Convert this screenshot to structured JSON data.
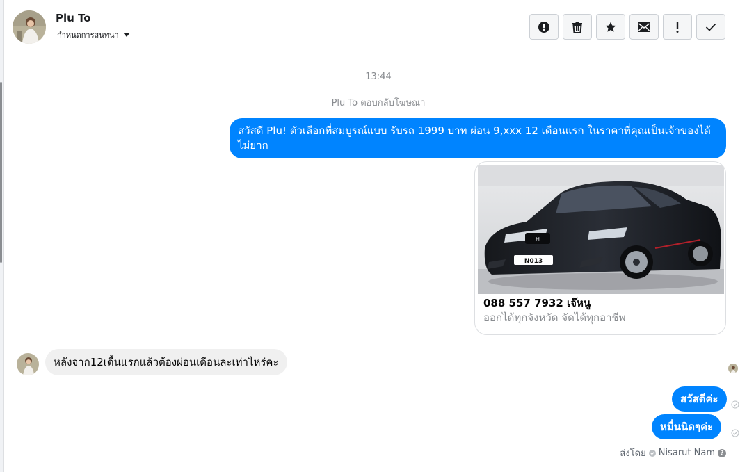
{
  "header": {
    "contact_name": "Plu To",
    "assign_label": "กำหนดการสนทนา",
    "tools": [
      {
        "icon": "spam-alert-icon",
        "label": "spam"
      },
      {
        "icon": "trash-icon",
        "label": "delete"
      },
      {
        "icon": "star-icon",
        "label": "star"
      },
      {
        "icon": "envelope-icon",
        "label": "mark-unread"
      },
      {
        "icon": "exclamation-icon",
        "label": "follow-up"
      },
      {
        "icon": "checkmark-icon",
        "label": "mark-done"
      }
    ]
  },
  "thread": {
    "timestamp": "13:44",
    "ad_reply_note": "Plu To ตอบกลับโฆษณา",
    "outgoing_main": "สวัสดี Plu! ตัวเลือกที่สมบูรณ์แบบ รับรถ 1999 บาท ผ่อน 9,xxx 12 เดือนแรก ในราคาที่คุณเป็นเจ้าของได้ไม่ยาก",
    "card": {
      "title": "088 557 7932 เจ๊หนู",
      "subtitle": "ออกได้ทุกจังหวัด จัดได้ทุกอาชีพ",
      "plate_text": "N013"
    },
    "incoming": "หลังจาก12เดื้นแรกแล้วต้องผ่อนเดือนละเท่าไหร่คะ",
    "reply_1": "สวัสดีค่ะ",
    "reply_2": "หมื่นนิดๆค่ะ",
    "sent_by_label": "ส่งโดย",
    "sent_by_name": "Nisarut Nam",
    "help_glyph": "?"
  },
  "colors": {
    "accent": "#0084ff",
    "incoming_bubble": "#f0f0f0",
    "muted_text": "#8a8d91"
  }
}
